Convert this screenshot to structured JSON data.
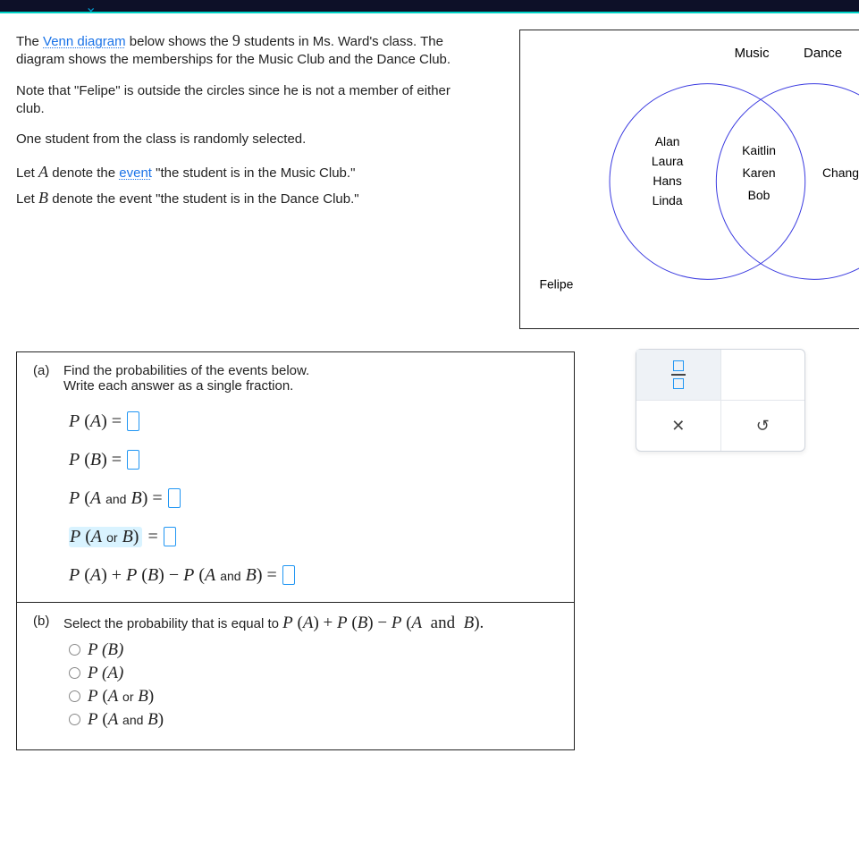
{
  "intro": {
    "p1_a": "The ",
    "p1_link": "Venn diagram",
    "p1_b": " below shows the ",
    "p1_num": "9",
    "p1_c": " students in Ms. Ward's class. The diagram shows the memberships for the Music Club and the Dance Club.",
    "p2": "Note that \"Felipe\" is outside the circles since he is not a member of either club.",
    "p3": "One student from the class is randomly selected.",
    "p4_a": "Let ",
    "p4_A": "A",
    "p4_b": " denote the ",
    "p4_link": "event",
    "p4_c": " \"the student is in the Music Club.\"",
    "p5_a": "Let ",
    "p5_B": "B",
    "p5_b": " denote the event \"the student is in the Dance Club.\""
  },
  "venn": {
    "label_left": "Music",
    "label_right": "Dance",
    "left_only": [
      "Alan",
      "Laura",
      "Hans",
      "Linda"
    ],
    "middle": [
      "Kaitlin",
      "Karen",
      "Bob"
    ],
    "right_only": [
      "Chang"
    ],
    "outside": "Felipe"
  },
  "partA": {
    "tag": "(a)",
    "q1": "Find the probabilities of the events below.",
    "q2": "Write each answer as a single fraction."
  },
  "partB": {
    "tag": "(b)",
    "q": "Select the probability that is equal to "
  },
  "options": {
    "o1": "P (B)",
    "o2": "P (A)"
  },
  "tool": {
    "x": "✕",
    "undo": "↺"
  }
}
